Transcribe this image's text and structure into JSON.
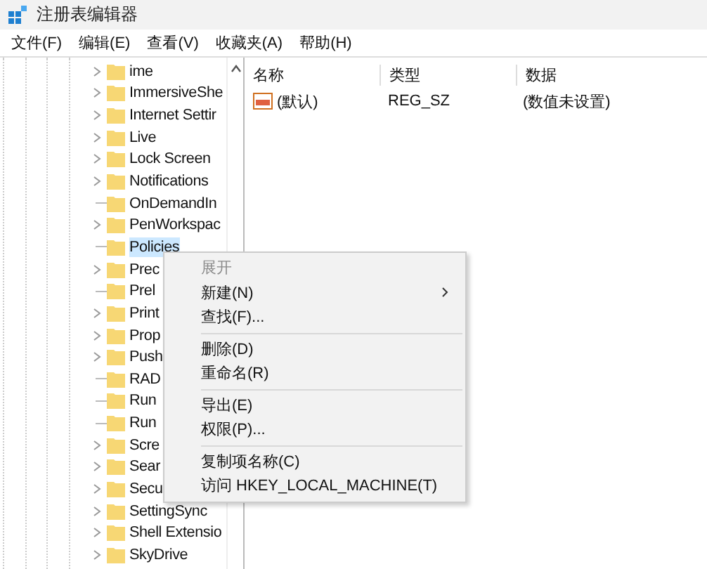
{
  "window": {
    "title": "注册表编辑器"
  },
  "menu_bar": [
    "文件(F)",
    "编辑(E)",
    "查看(V)",
    "收藏夹(A)",
    "帮助(H)"
  ],
  "tree": [
    {
      "label": "ime",
      "has_children": true,
      "selected": false
    },
    {
      "label": "ImmersiveShe",
      "has_children": true,
      "selected": false
    },
    {
      "label": "Internet Settir",
      "has_children": true,
      "selected": false
    },
    {
      "label": "Live",
      "has_children": true,
      "selected": false
    },
    {
      "label": "Lock Screen",
      "has_children": true,
      "selected": false
    },
    {
      "label": "Notifications",
      "has_children": true,
      "selected": false
    },
    {
      "label": "OnDemandIn",
      "has_children": false,
      "selected": false
    },
    {
      "label": "PenWorkspac",
      "has_children": true,
      "selected": false
    },
    {
      "label": "Policies",
      "has_children": false,
      "selected": true
    },
    {
      "label": "Prec",
      "has_children": true,
      "selected": false
    },
    {
      "label": "Prel",
      "has_children": false,
      "selected": false
    },
    {
      "label": "Print",
      "has_children": true,
      "selected": false
    },
    {
      "label": "Prop",
      "has_children": true,
      "selected": false
    },
    {
      "label": "Push",
      "has_children": true,
      "selected": false
    },
    {
      "label": "RAD",
      "has_children": false,
      "selected": false
    },
    {
      "label": "Run",
      "has_children": false,
      "selected": false
    },
    {
      "label": "Run",
      "has_children": false,
      "selected": false
    },
    {
      "label": "Scre",
      "has_children": true,
      "selected": false
    },
    {
      "label": "Sear",
      "has_children": true,
      "selected": false
    },
    {
      "label": "Secu",
      "has_children": true,
      "selected": false
    },
    {
      "label": "SettingSync",
      "has_children": true,
      "selected": false
    },
    {
      "label": "Shell Extensio",
      "has_children": true,
      "selected": false
    },
    {
      "label": "SkyDrive",
      "has_children": true,
      "selected": false
    }
  ],
  "table": {
    "columns": [
      "名称",
      "类型",
      "数据"
    ],
    "rows": [
      {
        "name": "(默认)",
        "type": "REG_SZ",
        "data": "(数值未设置)"
      }
    ]
  },
  "context_menu": [
    {
      "kind": "item",
      "label": "展开",
      "disabled": true,
      "submenu": false
    },
    {
      "kind": "item",
      "label": "新建(N)",
      "disabled": false,
      "submenu": true
    },
    {
      "kind": "item",
      "label": "查找(F)...",
      "disabled": false,
      "submenu": false
    },
    {
      "kind": "separator"
    },
    {
      "kind": "item",
      "label": "删除(D)",
      "disabled": false,
      "submenu": false
    },
    {
      "kind": "item",
      "label": "重命名(R)",
      "disabled": false,
      "submenu": false
    },
    {
      "kind": "separator"
    },
    {
      "kind": "item",
      "label": "导出(E)",
      "disabled": false,
      "submenu": false
    },
    {
      "kind": "item",
      "label": "权限(P)...",
      "disabled": false,
      "submenu": false
    },
    {
      "kind": "separator"
    },
    {
      "kind": "item",
      "label": "复制项名称(C)",
      "disabled": false,
      "submenu": false
    },
    {
      "kind": "item",
      "label": "访问 HKEY_LOCAL_MACHINE(T)",
      "disabled": false,
      "submenu": false
    }
  ]
}
